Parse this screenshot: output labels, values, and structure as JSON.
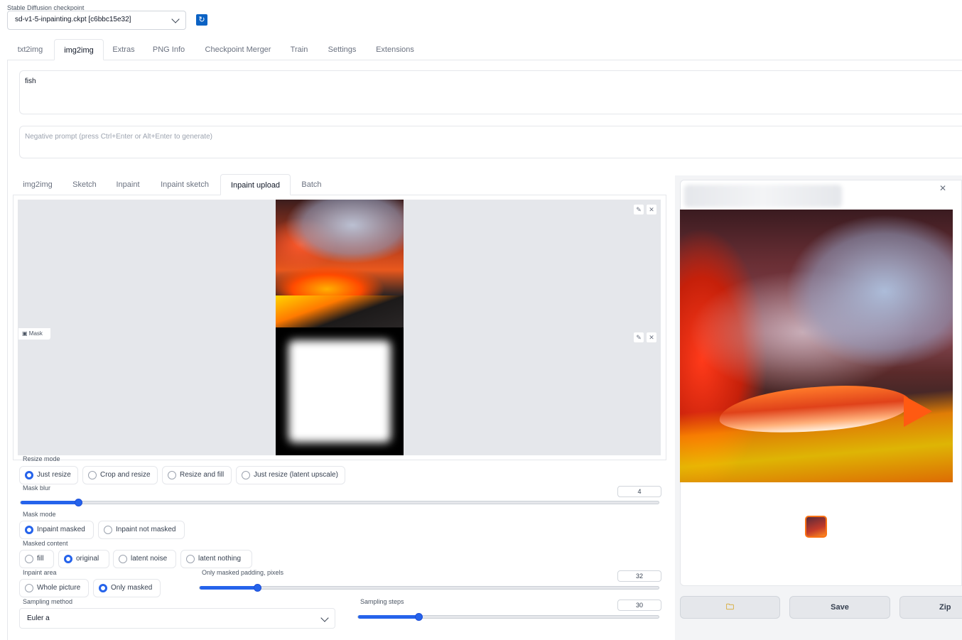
{
  "checkpoint": {
    "label": "Stable Diffusion checkpoint",
    "value": "sd-v1-5-inpainting.ckpt [c6bbc15e32]",
    "refresh_icon": "refresh-icon"
  },
  "top_tabs": [
    "txt2img",
    "img2img",
    "Extras",
    "PNG Info",
    "Checkpoint Merger",
    "Train",
    "Settings",
    "Extensions"
  ],
  "prompt": {
    "value": "fish",
    "negative_placeholder": "Negative prompt (press Ctrl+Enter or Alt+Enter to generate)"
  },
  "sub_tabs": [
    "img2img",
    "Sketch",
    "Inpaint",
    "Inpaint sketch",
    "Inpaint upload",
    "Batch"
  ],
  "active_sub_tab": "Inpaint upload",
  "mask_label": "Mask",
  "resize_mode": {
    "label": "Resize mode",
    "options": [
      "Just resize",
      "Crop and resize",
      "Resize and fill",
      "Just resize (latent upscale)"
    ],
    "selected": "Just resize"
  },
  "mask_blur": {
    "label": "Mask blur",
    "value": "4",
    "fraction": 0.09
  },
  "mask_mode": {
    "label": "Mask mode",
    "options": [
      "Inpaint masked",
      "Inpaint not masked"
    ],
    "selected": "Inpaint masked"
  },
  "masked_content": {
    "label": "Masked content",
    "options": [
      "fill",
      "original",
      "latent noise",
      "latent nothing"
    ],
    "selected": "original"
  },
  "inpaint_area": {
    "label": "Inpaint area",
    "options": [
      "Whole picture",
      "Only masked"
    ],
    "selected": "Only masked"
  },
  "padding": {
    "label": "Only masked padding, pixels",
    "value": "32",
    "fraction": 0.125
  },
  "sampling_method": {
    "label": "Sampling method",
    "value": "Euler a"
  },
  "sampling_steps": {
    "label": "Sampling steps",
    "value": "30",
    "fraction": 0.2
  },
  "output": {
    "buttons": [
      "Save",
      "Zip"
    ],
    "folder_icon": "folder-icon"
  }
}
